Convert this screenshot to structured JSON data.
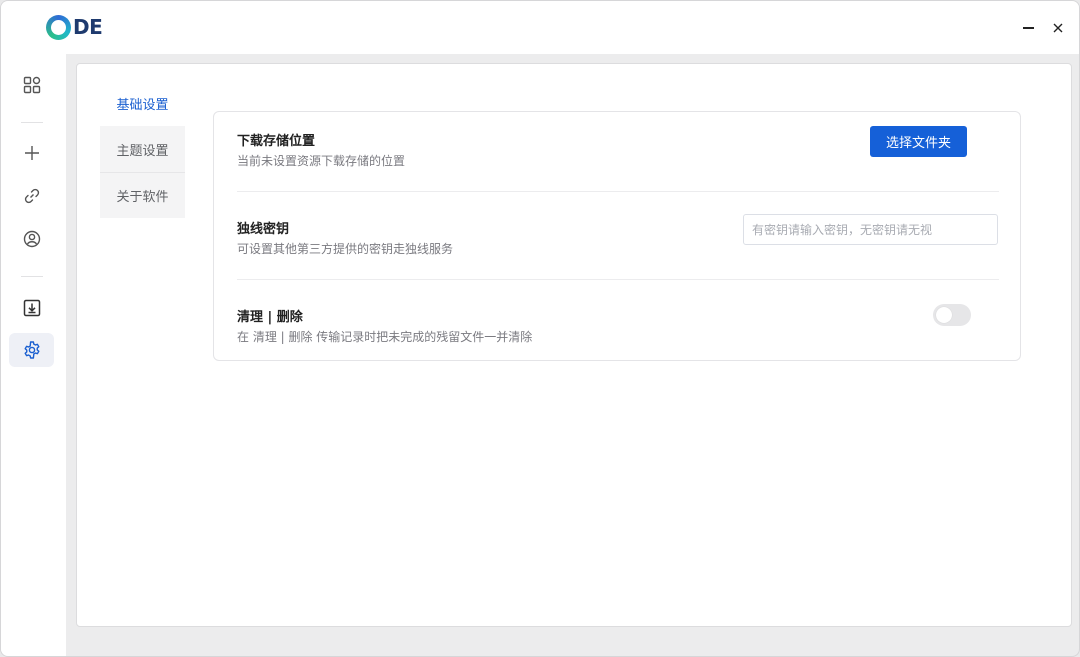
{
  "app": {
    "logo_text": "DE"
  },
  "window_controls": {
    "minimize": "minimize",
    "close": "✕"
  },
  "sidebar": {
    "items": [
      {
        "name": "grid-icon"
      },
      {
        "name": "plus-icon"
      },
      {
        "name": "link-icon"
      },
      {
        "name": "user-circle-icon"
      },
      {
        "name": "download-icon"
      },
      {
        "name": "gear-icon",
        "active": true
      }
    ]
  },
  "settings": {
    "tabs": [
      {
        "label": "基础设置",
        "active": true
      },
      {
        "label": "主题设置"
      },
      {
        "label": "关于软件"
      }
    ],
    "download_location": {
      "title": "下载存储位置",
      "description": "当前未设置资源下载存储的位置",
      "button_label": "选择文件夹"
    },
    "exclusive_key": {
      "title": "独线密钥",
      "description": "可设置其他第三方提供的密钥走独线服务",
      "input_value": "",
      "input_placeholder": "有密钥请输入密钥，无密钥请无视"
    },
    "cleanup": {
      "title": "清理 | 删除",
      "description": "在 清理 | 删除 传输记录时把未完成的残留文件一并清除",
      "toggle_on": false
    }
  },
  "colors": {
    "accent": "#1560d8",
    "active_tab_text": "#1a5fd0",
    "background": "#ececed"
  }
}
